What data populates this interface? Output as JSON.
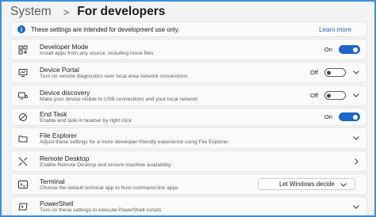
{
  "breadcrumb": {
    "parent": "System",
    "separator": ">",
    "current": "For developers"
  },
  "info": {
    "text": "These settings are intended for development use only.",
    "link": "Learn more"
  },
  "settings": [
    {
      "title": "Developer Mode",
      "subtitle": "Install apps from any source, including loose files",
      "state": "On",
      "icon": "developer-mode-icon"
    },
    {
      "title": "Device Portal",
      "subtitle": "Turn on remote diagnostics over local area network connections",
      "state": "Off",
      "icon": "device-portal-icon"
    },
    {
      "title": "Device discovery",
      "subtitle": "Make your device visible to USB connections and your local network",
      "state": "Off",
      "icon": "device-discovery-icon"
    },
    {
      "title": "End Task",
      "subtitle": "Enable end task in taskbar by right click",
      "state": "On",
      "icon": "end-task-icon"
    },
    {
      "title": "File Explorer",
      "subtitle": "Adjust these settings for a more developer-friendly experience using File Explorer",
      "icon": "folder-icon"
    },
    {
      "title": "Remote Desktop",
      "subtitle": "Enable Remote Desktop and ensure machine availability",
      "icon": "remote-desktop-icon"
    },
    {
      "title": "Terminal",
      "subtitle": "Choose the default terminal app to host command-line apps",
      "dropdown": "Let Windows decide",
      "icon": "terminal-icon"
    },
    {
      "title": "PowerShell",
      "subtitle": "Turn on these settings to execute PowerShell scripts",
      "icon": "powershell-icon"
    }
  ],
  "colors": {
    "accent": "#1e66c8",
    "background": "#f3f3f3",
    "card": "#fbfbfb"
  }
}
